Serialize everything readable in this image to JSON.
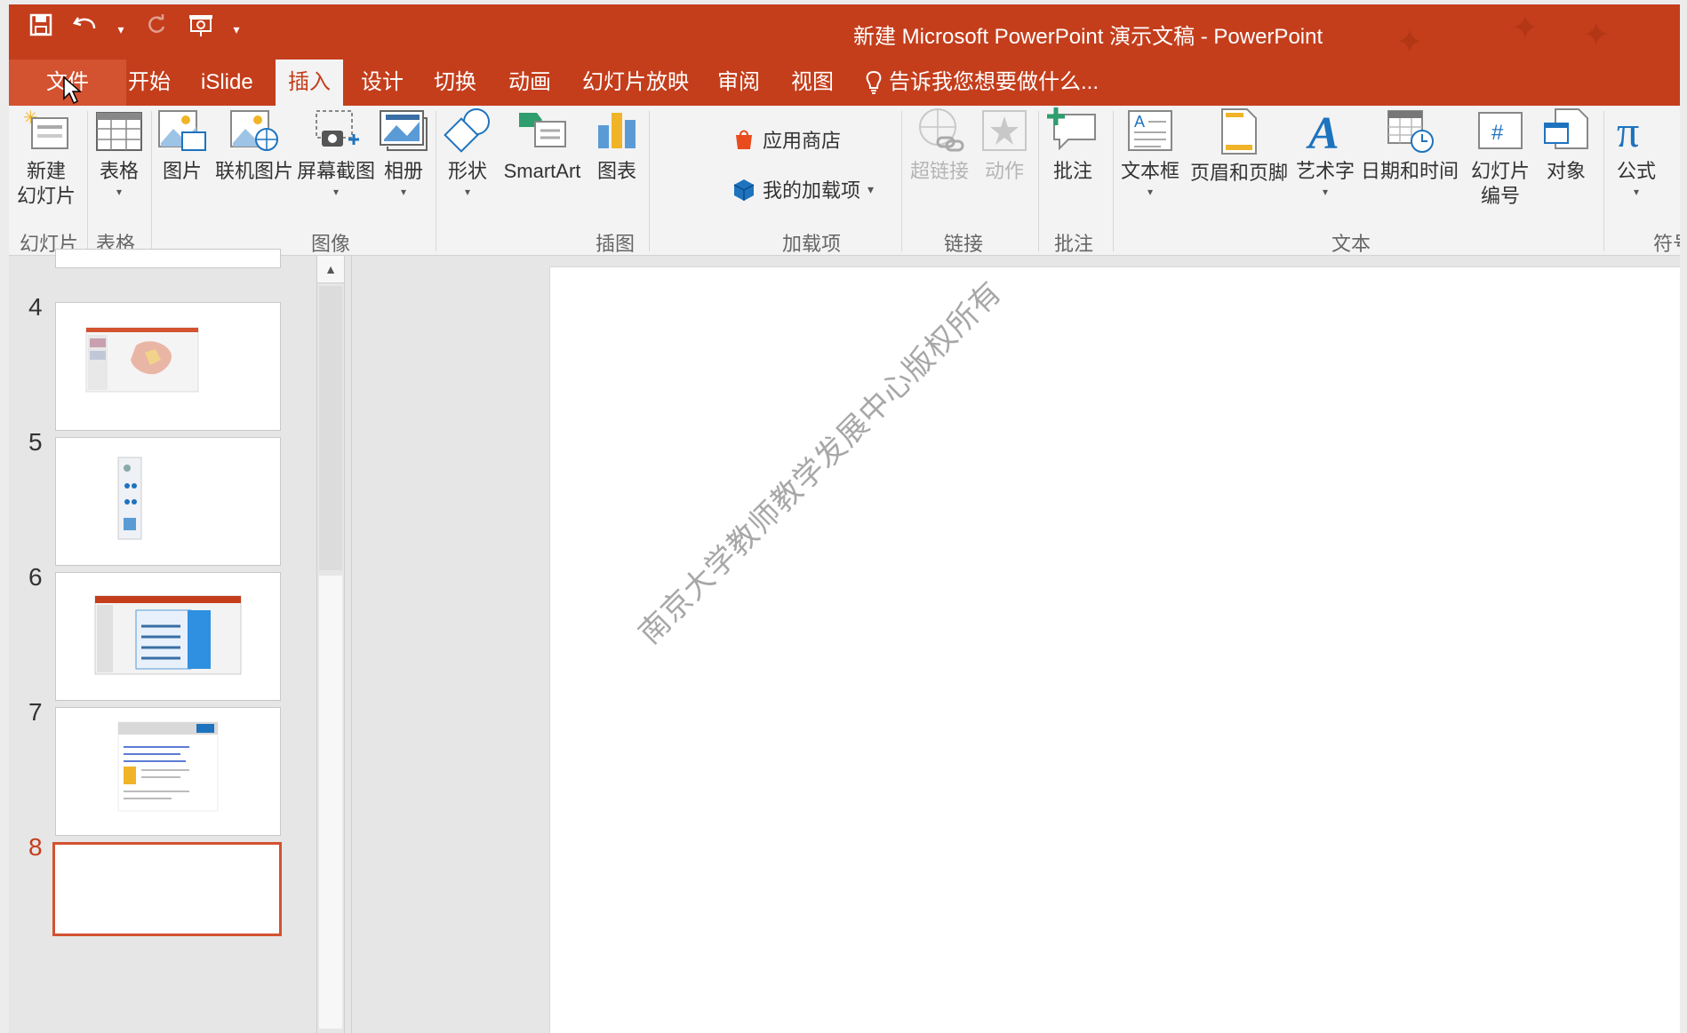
{
  "window": {
    "title": "新建 Microsoft PowerPoint 演示文稿 - PowerPoint",
    "accent": "#c43e1c"
  },
  "qat": {
    "save_icon": "save-icon",
    "undo_icon": "undo-icon",
    "redo_icon": "redo-icon",
    "present_icon": "start-from-beginning-icon"
  },
  "tabs": [
    {
      "label": "文件"
    },
    {
      "label": "开始"
    },
    {
      "label": "iSlide"
    },
    {
      "label": "插入"
    },
    {
      "label": "设计"
    },
    {
      "label": "切换"
    },
    {
      "label": "动画"
    },
    {
      "label": "幻灯片放映"
    },
    {
      "label": "审阅"
    },
    {
      "label": "视图"
    }
  ],
  "tell_me": "告诉我您想要做什么...",
  "ribbon": {
    "new_slide_line1": "新建",
    "new_slide_line2": "幻灯片",
    "table": "表格",
    "picture": "图片",
    "online_picture": "联机图片",
    "screenshot": "屏幕截图",
    "album": "相册",
    "shapes": "形状",
    "smartart": "SmartArt",
    "chart": "图表",
    "store": "应用商店",
    "my_addins": "我的加载项",
    "hyperlink": "超链接",
    "action": "动作",
    "comment": "批注",
    "textbox": "文本框",
    "header_footer": "页眉和页脚",
    "wordart": "艺术字",
    "datetime": "日期和时间",
    "slide_number_line1": "幻灯片",
    "slide_number_line2": "编号",
    "object": "对象",
    "equation": "公式",
    "groups": {
      "slides": "幻灯片",
      "tables": "表格",
      "images": "图像",
      "illustrations": "插图",
      "addins": "加载项",
      "links": "链接",
      "comments": "批注",
      "text": "文本",
      "symbols": "符号"
    }
  },
  "slides": [
    {
      "num": "4"
    },
    {
      "num": "5"
    },
    {
      "num": "6"
    },
    {
      "num": "7"
    },
    {
      "num": "8"
    }
  ],
  "watermark": "南京大学教师教学发展中心版权所有"
}
